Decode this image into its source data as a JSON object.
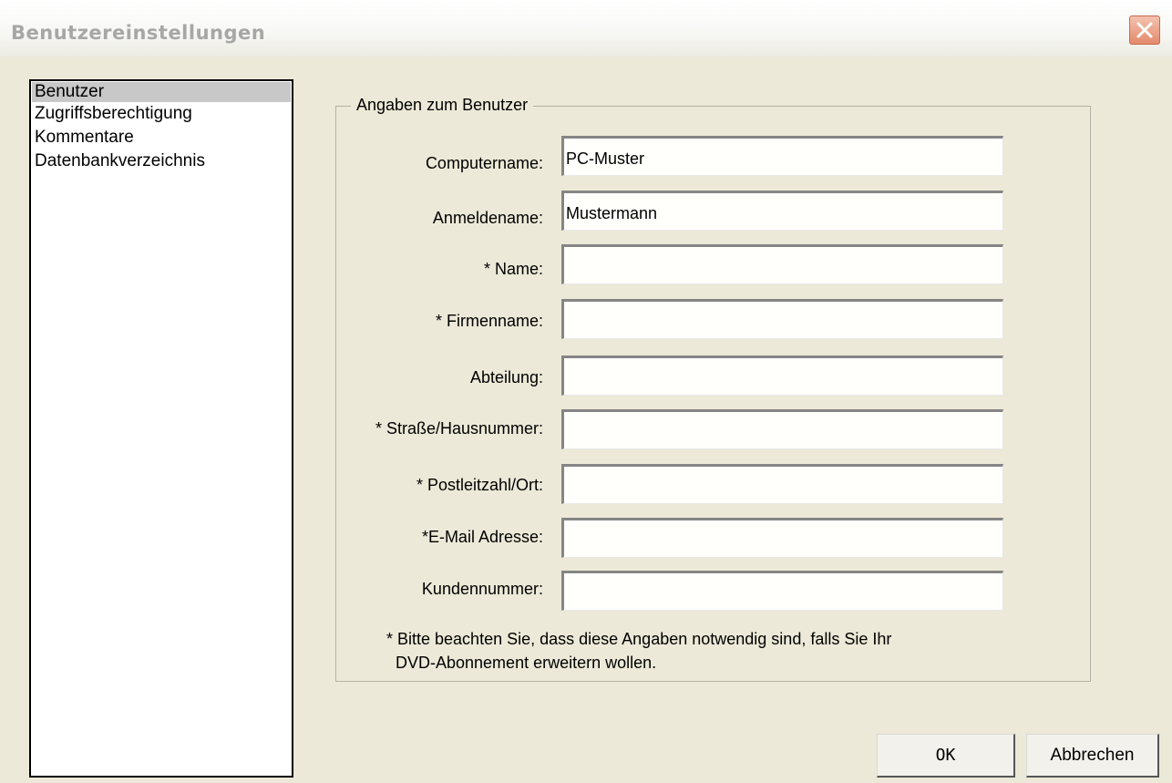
{
  "window": {
    "title": "Benutzereinstellungen",
    "close_icon": "close-icon"
  },
  "nav": {
    "items": [
      {
        "label": "Benutzer",
        "selected": true
      },
      {
        "label": "Zugriffsberechtigung",
        "selected": false
      },
      {
        "label": "Kommentare",
        "selected": false
      },
      {
        "label": "Datenbankverzeichnis",
        "selected": false
      }
    ]
  },
  "group": {
    "legend": "Angaben zum Benutzer",
    "fields": [
      {
        "label": "Computername:",
        "value": "PC-Muster"
      },
      {
        "label": "Anmeldename:",
        "value": "Mustermann"
      },
      {
        "label": "* Name:",
        "value": ""
      },
      {
        "label": "* Firmenname:",
        "value": ""
      },
      {
        "label": "Abteilung:",
        "value": ""
      },
      {
        "label": "* Straße/Hausnummer:",
        "value": ""
      },
      {
        "label": "* Postleitzahl/Ort:",
        "value": ""
      },
      {
        "label": "*E-Mail Adresse:",
        "value": ""
      },
      {
        "label": "Kundennummer:",
        "value": ""
      }
    ],
    "note": "* Bitte beachten Sie, dass diese Angaben notwendig sind, falls Sie Ihr\n  DVD-Abonnement erweitern wollen."
  },
  "buttons": {
    "ok": "OK",
    "cancel": "Abbrechen"
  },
  "colors": {
    "dialog_bg": "#ece9d8",
    "close_button": "#e48a6c",
    "selected_item": "#c8c8c8"
  }
}
